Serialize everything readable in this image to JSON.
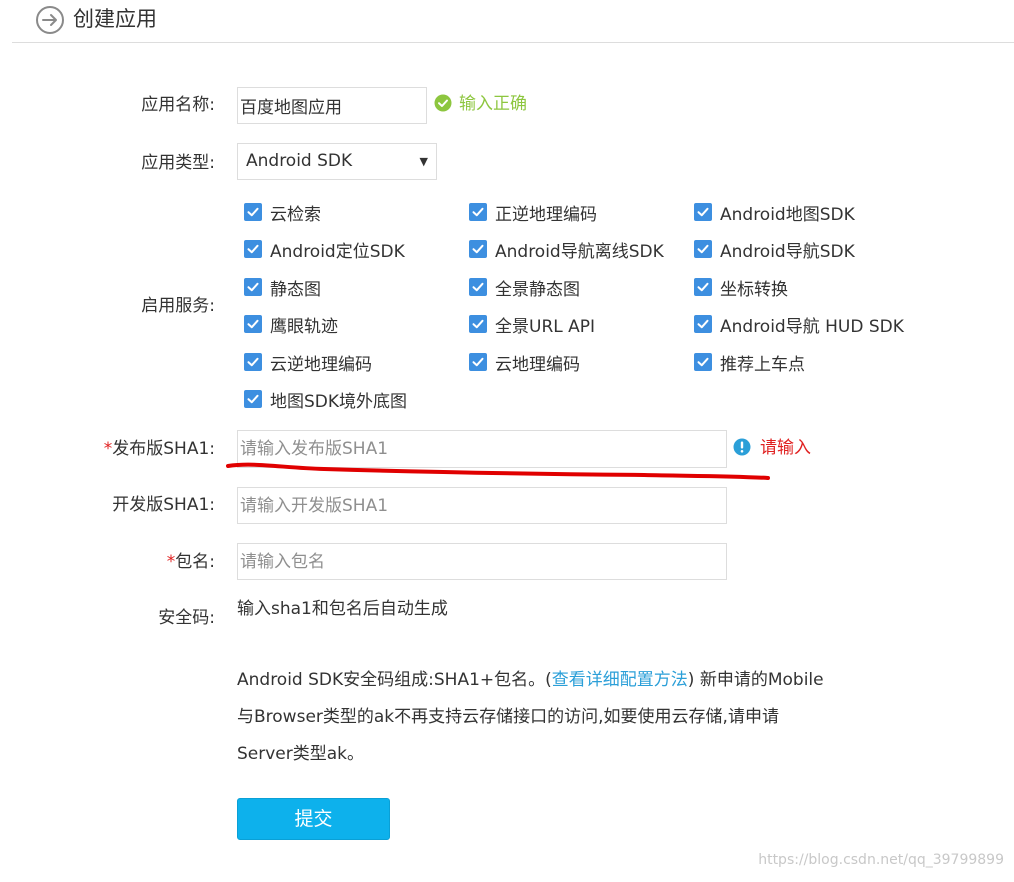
{
  "header": {
    "title": "创建应用"
  },
  "form": {
    "app_name": {
      "label": "应用名称:",
      "value": "百度地图应用",
      "status": "输入正确"
    },
    "app_type": {
      "label": "应用类型:",
      "selected": "Android SDK"
    },
    "services": {
      "label": "启用服务:",
      "items": [
        {
          "label": "云检索",
          "checked": true
        },
        {
          "label": "正逆地理编码",
          "checked": true
        },
        {
          "label": "Android地图SDK",
          "checked": true
        },
        {
          "label": "Android定位SDK",
          "checked": true
        },
        {
          "label": "Android导航离线SDK",
          "checked": true
        },
        {
          "label": "Android导航SDK",
          "checked": true
        },
        {
          "label": "静态图",
          "checked": true
        },
        {
          "label": "全景静态图",
          "checked": true
        },
        {
          "label": "坐标转换",
          "checked": true
        },
        {
          "label": "鹰眼轨迹",
          "checked": true
        },
        {
          "label": "全景URL API",
          "checked": true
        },
        {
          "label": "Android导航 HUD SDK",
          "checked": true
        },
        {
          "label": "云逆地理编码",
          "checked": true
        },
        {
          "label": "云地理编码",
          "checked": true
        },
        {
          "label": "推荐上车点",
          "checked": true
        },
        {
          "label": "地图SDK境外底图",
          "checked": true
        }
      ]
    },
    "release_sha1": {
      "required_mark": "*",
      "label": "发布版SHA1:",
      "placeholder": "请输入发布版SHA1",
      "error": "请输入"
    },
    "dev_sha1": {
      "label": "开发版SHA1:",
      "placeholder": "请输入开发版SHA1"
    },
    "package_name": {
      "required_mark": "*",
      "label": "包名:",
      "placeholder": "请输入包名"
    },
    "security_code": {
      "label": "安全码:",
      "text": "输入sha1和包名后自动生成"
    },
    "info": {
      "line1_pre": "Android SDK安全码组成:SHA1+包名。(",
      "link": "查看详细配置方法",
      "line1_post": ") 新申请的Mobile",
      "line2": "与Browser类型的ak不再支持云存储接口的访问,如要使用云存储,请申请",
      "line3": "Server类型ak。"
    },
    "submit_label": "提交"
  },
  "watermark": "https://blog.csdn.net/qq_39799899",
  "colors": {
    "ok_green": "#8dc63f",
    "error_red": "#e02020",
    "checkbox_blue": "#3d8fe0",
    "link_blue": "#2b9fd8",
    "button_blue": "#0db1ec"
  }
}
